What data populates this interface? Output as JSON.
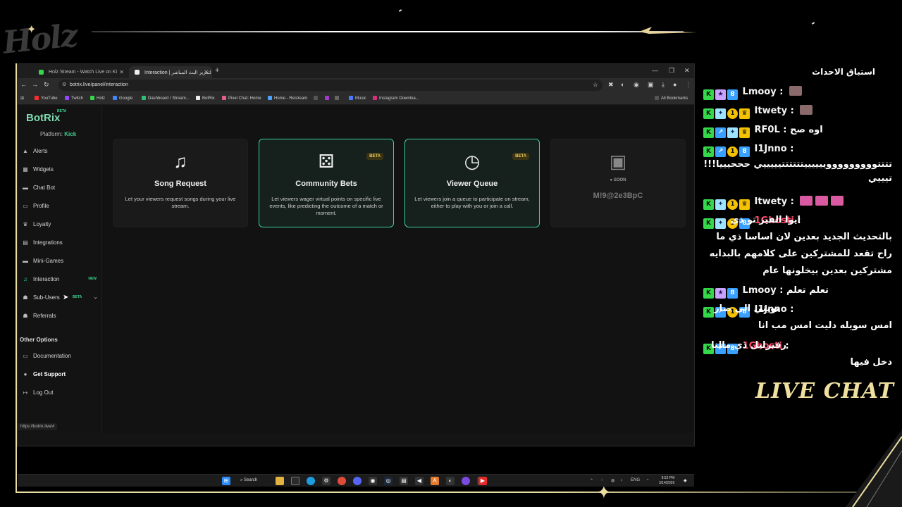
{
  "overlay": {
    "logo_text": "Holz",
    "live_chat_label": "LIVE CHAT"
  },
  "browser": {
    "tabs": [
      {
        "title": "Holz Stream - Watch Live on Ki"
      },
      {
        "title": "Interaction | لتعزيز البث المباشر"
      }
    ],
    "url": "botrix.live/panel/interaction",
    "bookmarks": [
      "YouTube",
      "Twitch",
      "Holz",
      "Google",
      "Dashboard / Stream...",
      "BotRix",
      "Pixel Chat: Home",
      "Home - Restream",
      "Music",
      "Instagram Downloa..."
    ],
    "all_bookmarks": "All Bookmarks",
    "status_url": "https://botrix.live/#"
  },
  "sidebar": {
    "brand": "BotRix",
    "brand_badge": "BETA",
    "platform_label": "Platform:",
    "platform_value": "Kick",
    "items": [
      {
        "label": "Alerts",
        "icon": "warning-icon"
      },
      {
        "label": "Widgets",
        "icon": "grid-icon"
      },
      {
        "label": "Chat Bot",
        "icon": "chat-icon"
      },
      {
        "label": "Profile",
        "icon": "profile-icon"
      },
      {
        "label": "Loyalty",
        "icon": "trophy-icon"
      },
      {
        "label": "Integrations",
        "icon": "integrations-icon"
      },
      {
        "label": "Mini-Games",
        "icon": "gamepad-icon"
      },
      {
        "label": "Interaction",
        "icon": "music-icon",
        "badge": "NEW"
      },
      {
        "label": "Sub-Users",
        "icon": "users-icon",
        "badge": "BETA"
      },
      {
        "label": "Referrals",
        "icon": "referrals-icon"
      }
    ],
    "other_options_label": "Other Options",
    "other_items": [
      {
        "label": "Documentation",
        "icon": "doc-icon"
      },
      {
        "label": "Get Support",
        "icon": "help-icon"
      },
      {
        "label": "Log Out",
        "icon": "logout-icon"
      }
    ]
  },
  "cards": [
    {
      "title": "Song Request",
      "desc": "Let your viewers request songs during your live stream.",
      "icon": "music-note-icon"
    },
    {
      "title": "Community Bets",
      "desc": "Let viewers wager virtual points on specific live events, like predicting the outcome of a match or moment.",
      "badge": "BETA",
      "icon": "dice-icon"
    },
    {
      "title": "Viewer Queue",
      "desc": "Let viewers join a queue to participate on stream, either to play with you or join a call.",
      "badge": "BETA",
      "icon": "clock-icon"
    },
    {
      "title": "M!9@2e3BpC",
      "soon": "SOON",
      "icon": "ticket-icon"
    }
  ],
  "taskbar": {
    "search_label": "Search",
    "lang": "ENG",
    "time": "9:52 PM",
    "date": "3/14/2026"
  },
  "chat": {
    "title": "استباق الاحداث",
    "messages": [
      {
        "user": "Lmooy",
        "text": ""
      },
      {
        "user": "Itwety",
        "text": ""
      },
      {
        "user": "RF0L",
        "text": "اوه صح"
      },
      {
        "user": "I1Jnno",
        "text": "تتتتوووووووووييييييتتتتتتيييييي حححيييا!!!تيييي"
      },
      {
        "user": "Itwety",
        "text": ""
      },
      {
        "user": "1Ghosti",
        "text": "ايوا الفيز تو ذي بالتحديث الجديد بعدين لان اساسا ذي ما راح تقعد للمشتركين على كلامهم بالبدايه مشتركين بعدين بيخلونها عام"
      },
      {
        "user": "Lmooy",
        "text": "تعلم تعلم"
      },
      {
        "user": "I1Jnno",
        "text": "تويتي الي صار امس سويله دليت امس مب انا"
      },
      {
        "user": "1Ghosti",
        "text": "رفيرليل ذي مالنا دخل فيها"
      }
    ]
  }
}
